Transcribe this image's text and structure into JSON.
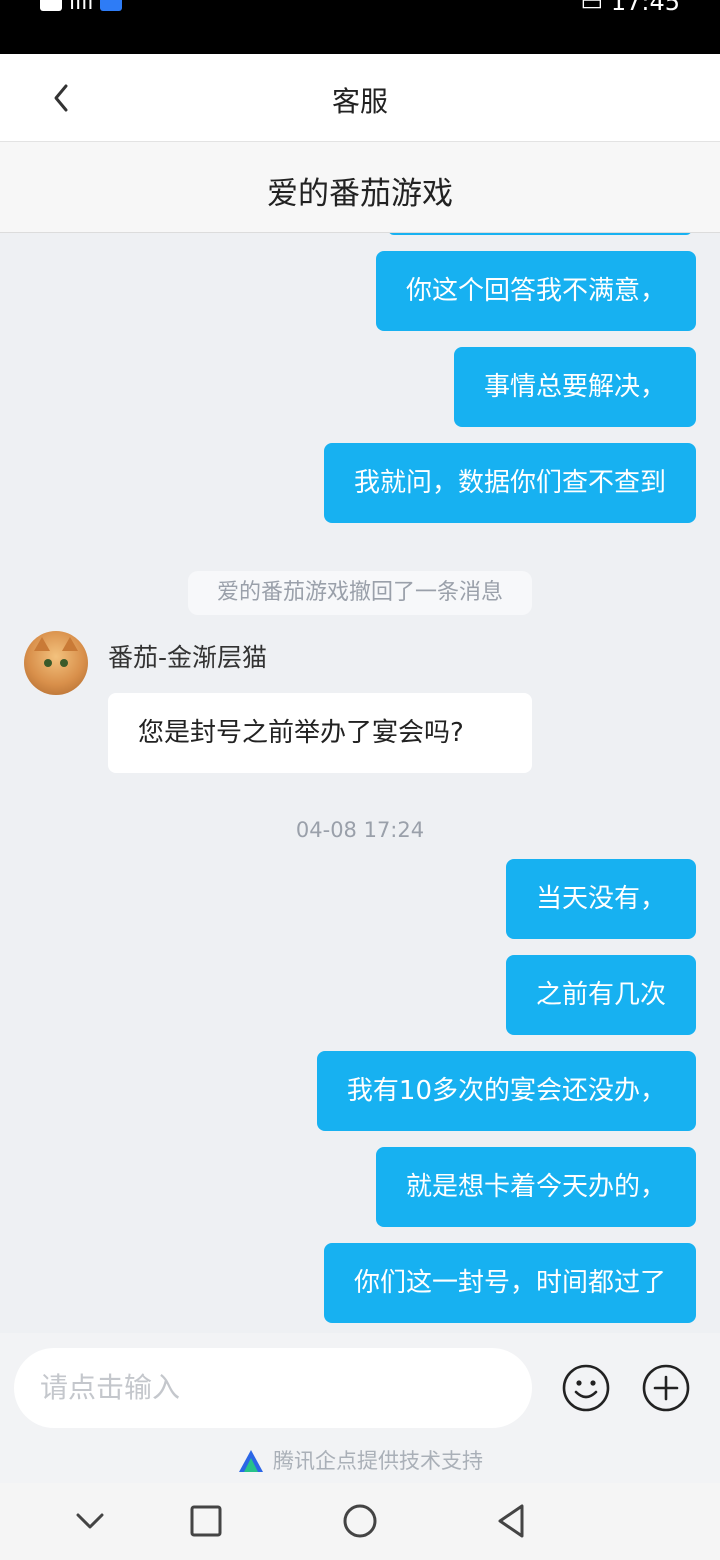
{
  "status_bar": {
    "time": "17:45"
  },
  "header": {
    "title": "客服"
  },
  "subheader": {
    "title": "爱的番茄游戏"
  },
  "messages": {
    "m1": "你这个回答我不满意，",
    "m2": "事情总要解决，",
    "m3": "我就问，数据你们查不查到",
    "recall_notice": "爱的番茄游戏撤回了一条消息",
    "agent_name": "番茄-金渐层猫",
    "agent_msg": "您是封号之前举办了宴会吗?",
    "timestamp": "04-08 17:24",
    "m4": "当天没有，",
    "m5": "之前有几次",
    "m6": "我有10多次的宴会还没办，",
    "m7": "就是想卡着今天办的，",
    "m8": "你们这一封号，时间都过了"
  },
  "input": {
    "placeholder": "请点击输入"
  },
  "footer": {
    "powered_by": "腾讯企点提供技术支持"
  },
  "colors": {
    "bubble_blue": "#17b1f1",
    "background": "#eef0f3"
  }
}
